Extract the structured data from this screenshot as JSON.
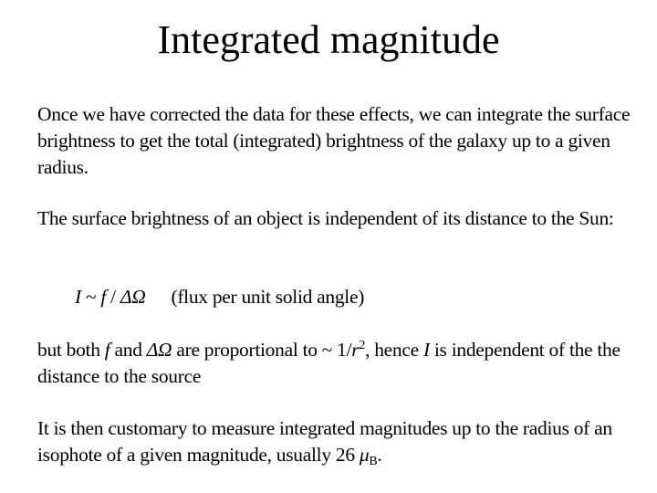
{
  "slide": {
    "title": "Integrated magnitude",
    "paragraph1": "Once we have corrected the data for these effects, we can integrate the surface brightness to get the total (integrated) brightness of the galaxy up to a given radius.",
    "paragraph2": "The surface brightness of an object is independent of its distance to the Sun:",
    "equation": {
      "lhs": "I",
      "op": " ~ ",
      "f": "f",
      "slash": " / ",
      "delta_omega": "ΔΩ",
      "description": "(flux per unit solid angle)"
    },
    "paragraph3": {
      "part1": "but both ",
      "f": "f",
      "part2": " and ",
      "delta_omega": "ΔΩ",
      "part3": "  are proportional to ~ 1/",
      "r": "r",
      "exponent": "2",
      "part4": ", hence ",
      "I": "I",
      "part5": " is independent of the the distance to the source"
    },
    "paragraph4": {
      "text": "It is then customary to measure integrated magnitudes up to the radius of an isophote of a given magnitude, usually 26 ",
      "mu": "μ",
      "subscript": "B",
      "end": "."
    }
  }
}
